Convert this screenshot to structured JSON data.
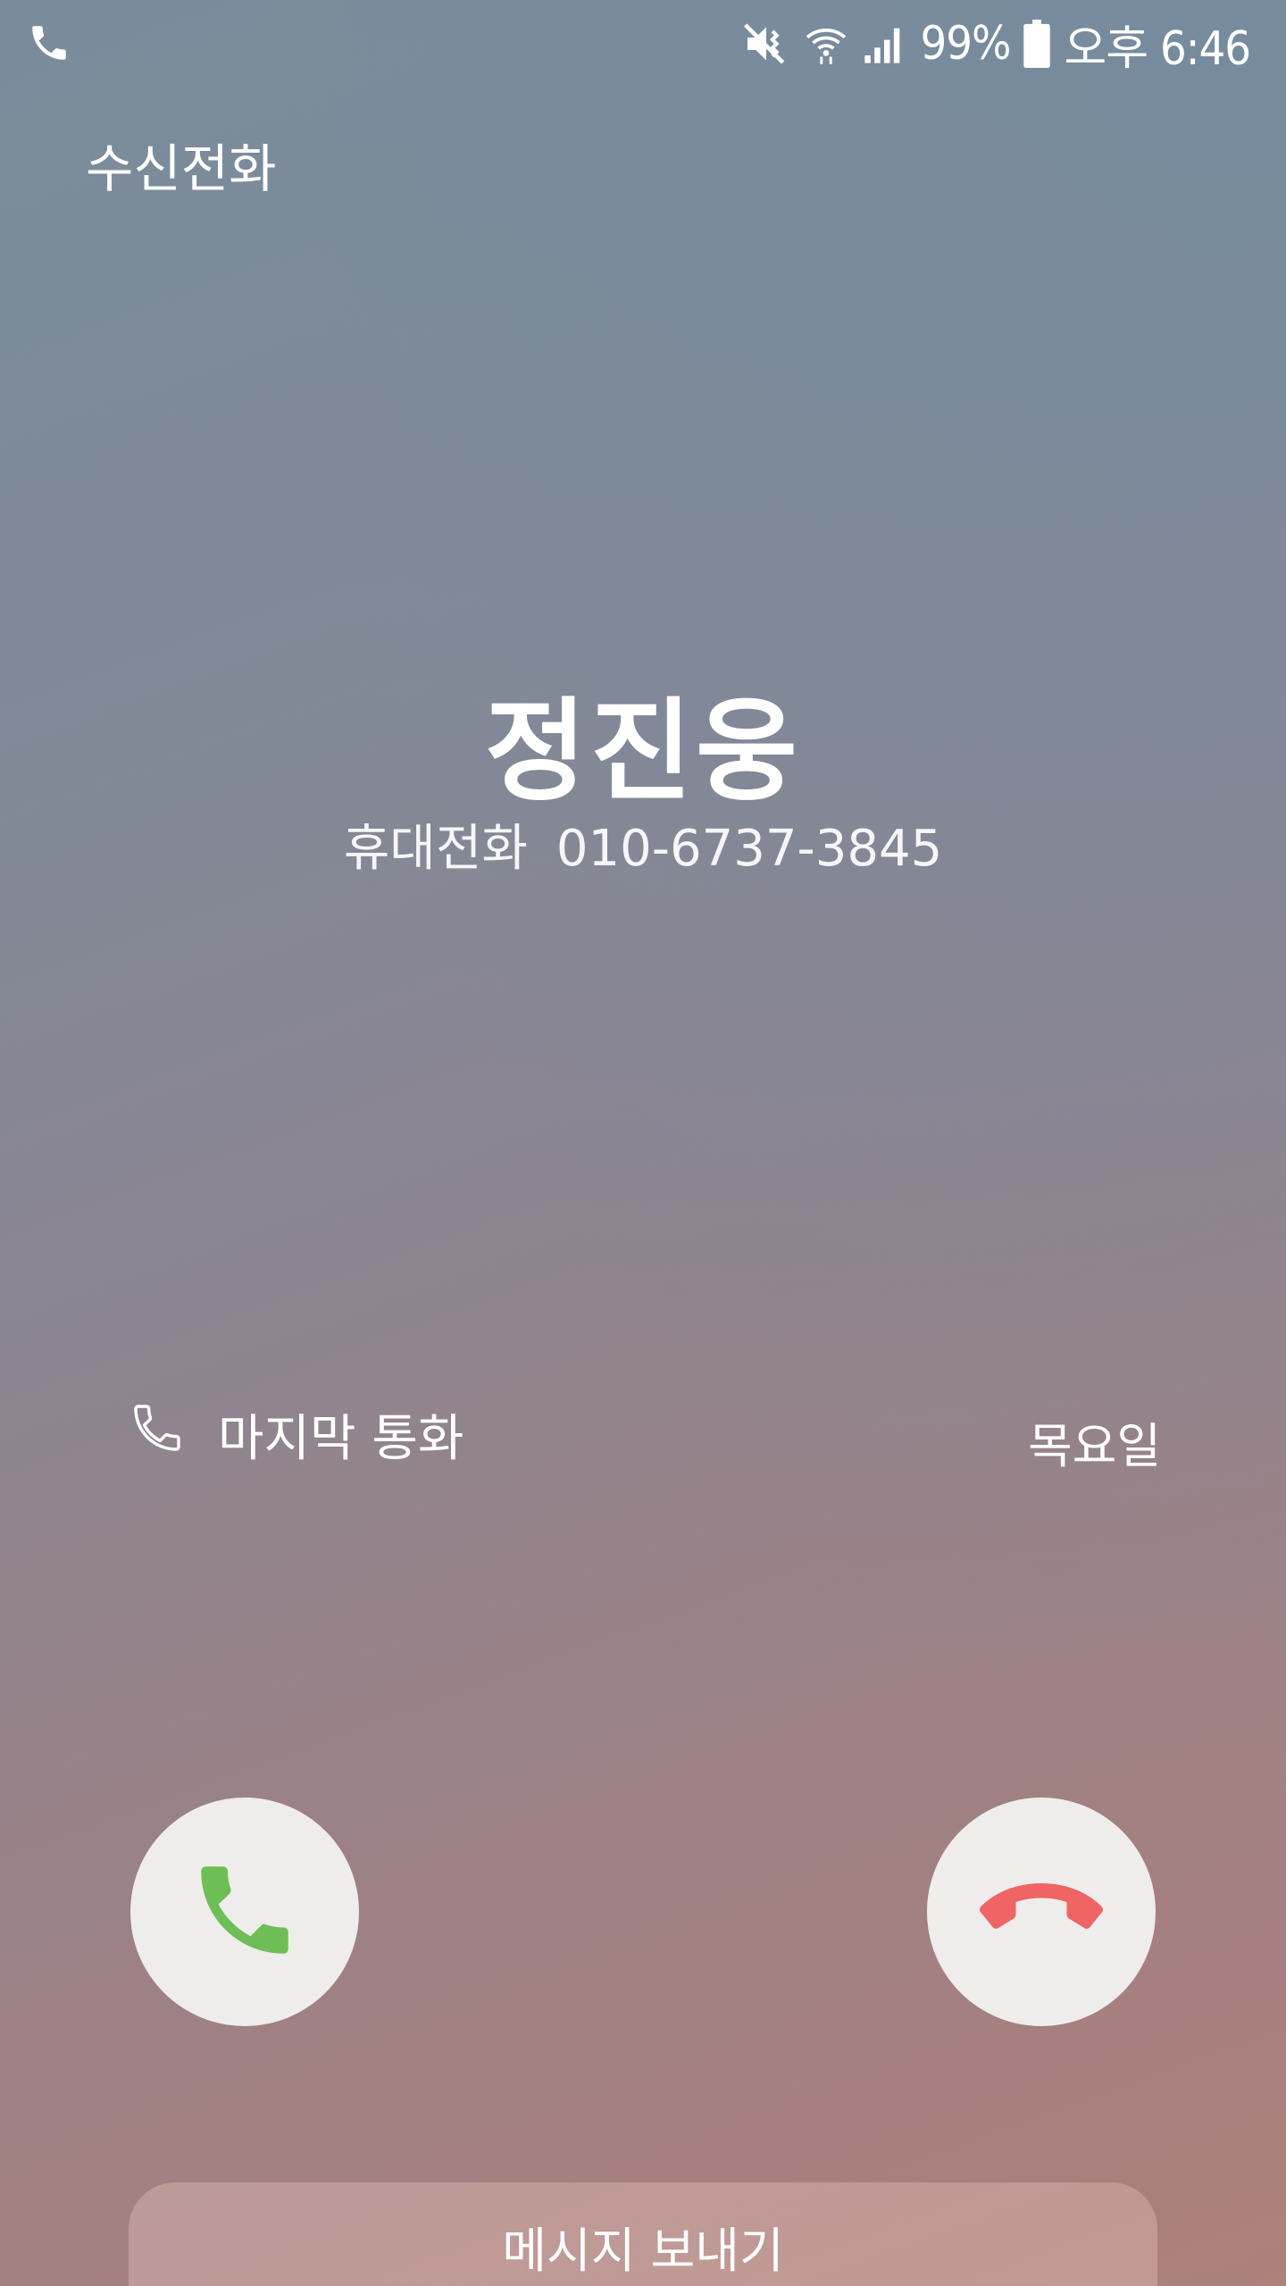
{
  "status_bar": {
    "battery": "99%",
    "time": "오후 6:46",
    "icons": [
      "phone-icon",
      "mute-icon",
      "wifi-icon",
      "signal-icon",
      "battery-icon"
    ]
  },
  "screen": {
    "title": "수신전화"
  },
  "caller": {
    "name": "정진웅",
    "number_type": "휴대전화",
    "number": "010-6737-3845"
  },
  "last_call": {
    "label": "마지막 통화",
    "day": "목요일",
    "icon": "phone-outline-icon"
  },
  "actions": {
    "accept_icon": "phone-accept-icon",
    "decline_icon": "phone-decline-icon",
    "accept_color": "#6dbf55",
    "decline_color": "#f06464",
    "message_label": "메시지 보내기"
  }
}
